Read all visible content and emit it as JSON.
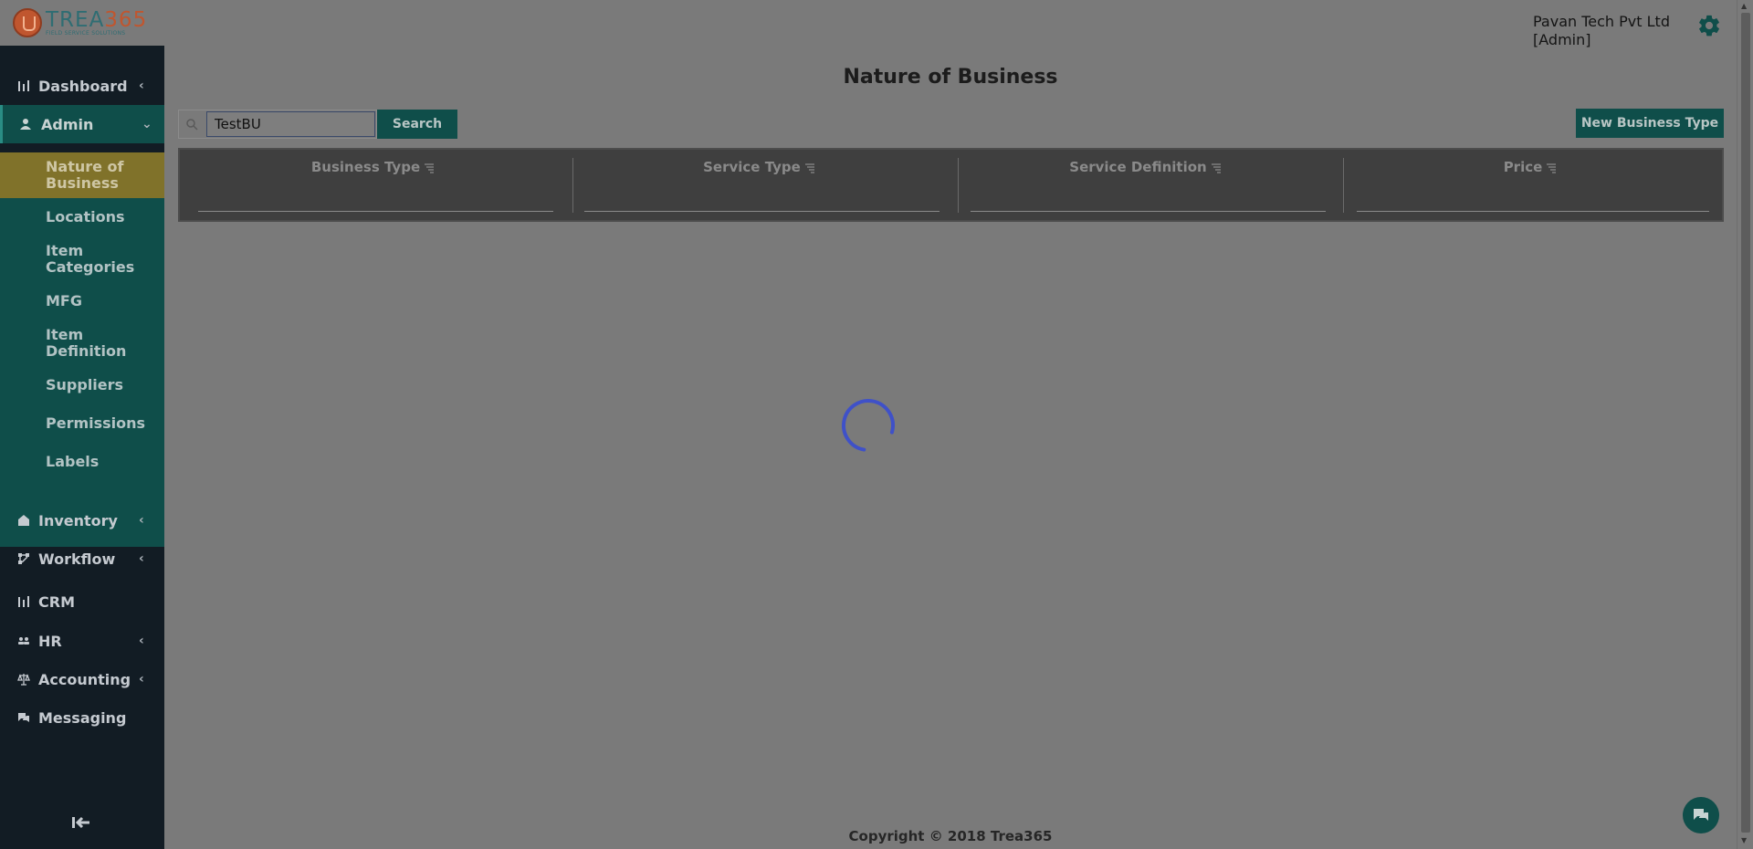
{
  "brand": {
    "word": "TREA",
    "num": "365",
    "tagline": "FIELD SERVICE SOLUTIONS"
  },
  "header": {
    "company_line1": "Pavan Tech Pvt Ltd",
    "company_line2": "[Admin]"
  },
  "sidebar": {
    "items": [
      {
        "label": "Dashboard",
        "icon": "bar-chart-icon",
        "chevron": "‹"
      },
      {
        "label": "Admin",
        "icon": "user-cog-icon",
        "chevron": "⌄"
      },
      {
        "label": "Inventory",
        "icon": "warehouse-icon",
        "chevron": "‹"
      },
      {
        "label": "Workflow",
        "icon": "workflow-icon",
        "chevron": "‹"
      },
      {
        "label": "CRM",
        "icon": "bar-chart-icon"
      },
      {
        "label": "HR",
        "icon": "people-icon",
        "chevron": "‹"
      },
      {
        "label": "Accounting",
        "icon": "scale-icon",
        "chevron": "‹"
      },
      {
        "label": "Messaging",
        "icon": "chat-icon"
      }
    ],
    "admin_submenu": [
      {
        "label": "Nature of Business"
      },
      {
        "label": "Locations"
      },
      {
        "label": "Item Categories"
      },
      {
        "label": "MFG"
      },
      {
        "label": "Item Definition"
      },
      {
        "label": "Suppliers"
      },
      {
        "label": "Permissions"
      },
      {
        "label": "Labels"
      }
    ],
    "collapse_icon": "collapse-left-icon"
  },
  "main": {
    "title": "Nature of Business",
    "search": {
      "value": "TestBU",
      "button": "Search"
    },
    "new_button": "New Business Type",
    "columns": [
      "Business Type",
      "Service Type",
      "Service Definition",
      "Price"
    ]
  },
  "footer": {
    "copyright": "Copyright © 2018 Trea365"
  },
  "colors": {
    "sidebar_bg": "#121c24",
    "teal": "#0f4e4a",
    "active_sub": "#80722a",
    "spinner": "#3f51c8"
  }
}
